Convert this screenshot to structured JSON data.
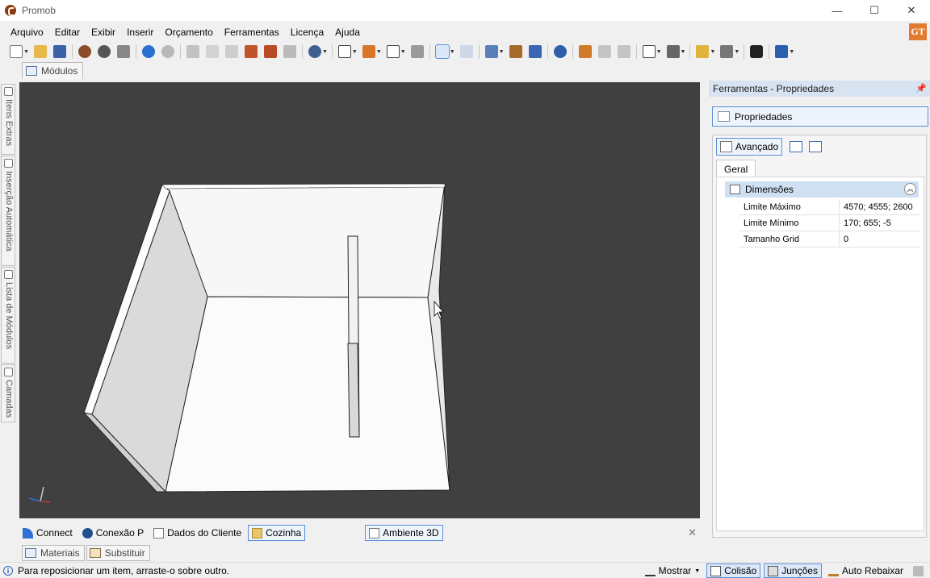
{
  "window": {
    "title": "Promob",
    "minimize": "—",
    "maximize": "☐",
    "close": "✕"
  },
  "badge": "GT",
  "menu": [
    "Arquivo",
    "Editar",
    "Exibir",
    "Inserir",
    "Orçamento",
    "Ferramentas",
    "Licença",
    "Ajuda"
  ],
  "top_tab": {
    "label": "Módulos"
  },
  "left_tabs": [
    "Itens Extras",
    "Inserção Automática",
    "Lista de Módulos",
    "Camadas"
  ],
  "bottom_tabs": {
    "items": [
      "Connect",
      "Conexão P",
      "Dados do Cliente",
      "Cozinha",
      "Ambiente 3D"
    ],
    "close": "✕"
  },
  "bottom_tabs2": [
    "Materiais",
    "Substituir"
  ],
  "status": {
    "info": "i",
    "text": "Para reposicionar um item, arraste-o sobre outro.",
    "mostrar": "Mostrar",
    "colisao": "Colisão",
    "juncoes": "Junções",
    "auto_rebaixar": "Auto Rebaixar"
  },
  "panel": {
    "title": "Ferramentas - Propriedades",
    "pin": "📌",
    "properties_button": "Propriedades",
    "advanced_button": "Avançado",
    "tab": "Geral",
    "category": "Dimensões",
    "collapse": "︽",
    "rows": [
      {
        "name": "Limite Máximo",
        "value": "4570; 4555; 2600"
      },
      {
        "name": "Limite Mínimo",
        "value": "170; 655; -5"
      },
      {
        "name": "Tamanho Grid",
        "value": "0"
      }
    ]
  },
  "colors": {
    "accent": "#5a8fd6",
    "viewport_bg": "#404040",
    "panel_header": "#d7e3f1",
    "badge": "#e07b30"
  }
}
